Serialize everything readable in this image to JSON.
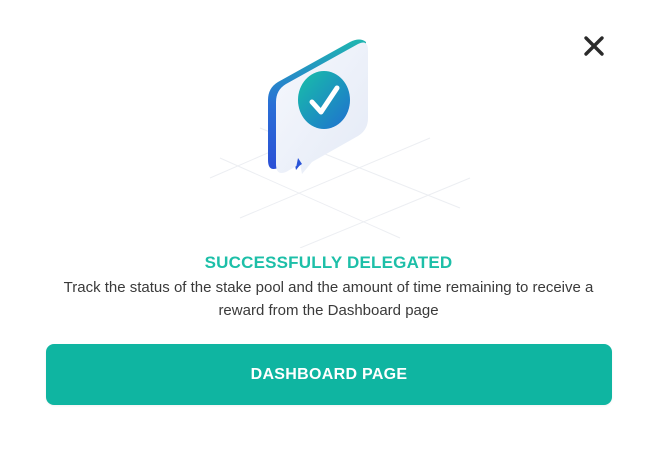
{
  "dialog": {
    "close_icon": "close-icon",
    "illustration_icon": "check-speech-bubble-icon",
    "title": "SUCCESSFULLY DELEGATED",
    "message": "Track the status of the stake pool and the amount of time remaining to receive a reward from the Dashboard page",
    "button_label": "DASHBOARD PAGE"
  },
  "colors": {
    "accent": "#12b8a3",
    "title": "#1dbfa8",
    "button": "#0fb5a1",
    "bubble_dark": "#2b55d8",
    "bubble_light": "#eef2fb",
    "text": "#3a3a3a",
    "close": "#2a2a2a"
  }
}
